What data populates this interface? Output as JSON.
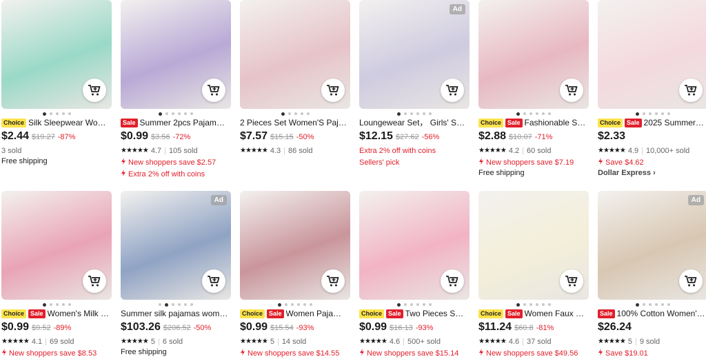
{
  "row1": [
    {
      "badges": [
        "Choice"
      ],
      "title": "Silk Sleepwear Women...",
      "price": "$2.44",
      "orig": "$19.27",
      "disc": "-87%",
      "rating": "",
      "sold": "3 sold",
      "line1": "",
      "line1_type": "",
      "line2": "Free shipping",
      "line2_type": "plain",
      "ad": false,
      "bg": "#9ad9c7",
      "dots": 5,
      "dot_on": 0
    },
    {
      "badges": [
        "Sale"
      ],
      "title": "Summer 2pcs Pajamas S...",
      "price": "$0.99",
      "orig": "$3.56",
      "disc": "-72%",
      "rating": "4.7",
      "sold": "105 sold",
      "line1": "New shoppers save $2.57",
      "line1_type": "red",
      "line2": "Extra 2% off with coins",
      "line2_type": "red",
      "ad": false,
      "bg": "#b8a9d6",
      "dots": 6,
      "dot_on": 0
    },
    {
      "badges": [],
      "title": "2 Pieces Set Women'S Pajama...",
      "price": "$7.57",
      "orig": "$15.15",
      "disc": "-50%",
      "rating": "4.3",
      "sold": "86 sold",
      "line1": "",
      "line1_type": "",
      "line2": "",
      "line2_type": "",
      "ad": false,
      "bg": "#e6c3c9",
      "dots": 5,
      "dot_on": 0
    },
    {
      "badges": [],
      "title": "Loungewear Set， Girls' Sum...",
      "price": "$12.15",
      "orig": "$27.62",
      "disc": "-56%",
      "rating": "",
      "sold": "",
      "line1": "Extra 2% off with coins",
      "line1_type": "redplain",
      "line2": "Sellers' pick",
      "line2_type": "redplain",
      "ad": true,
      "bg": "#cfcbe0",
      "dots": 6,
      "dot_on": 0
    },
    {
      "badges": [
        "Choice",
        "Sale"
      ],
      "title": "Fashionable Sexy I...",
      "price": "$2.88",
      "orig": "$10.07",
      "disc": "-71%",
      "rating": "4.2",
      "sold": "60 sold",
      "line1": "New shoppers save $7.19",
      "line1_type": "red",
      "line2": "Free shipping",
      "line2_type": "plain",
      "ad": false,
      "bg": "#e8b8c2",
      "dots": 6,
      "dot_on": 0
    },
    {
      "badges": [
        "Choice",
        "Sale"
      ],
      "title": "2025 Summer 2 P...",
      "price": "$2.33",
      "orig": "",
      "disc": "",
      "rating": "4.9",
      "sold": "10,000+ sold",
      "line1": "Save $4.62",
      "line1_type": "red",
      "line2": "Dollar Express ›",
      "line2_type": "bold",
      "ad": false,
      "bg": "#f4d9df",
      "dots": 6,
      "dot_on": 0
    }
  ],
  "row2": [
    {
      "badges": [
        "Choice",
        "Sale"
      ],
      "title": "Women's Milk Silk ...",
      "price": "$0.99",
      "orig": "$9.52",
      "disc": "-89%",
      "rating": "4.1",
      "sold": "69 sold",
      "line1": "New shoppers save $8.53",
      "line1_type": "red",
      "ad": false,
      "bg": "#e9a3b6",
      "dots": 5,
      "dot_on": 0
    },
    {
      "badges": [],
      "title": "Summer silk pajamas women's...",
      "price": "$103.26",
      "orig": "$206.52",
      "disc": "-50%",
      "rating": "5",
      "sold": "6 sold",
      "line1": "Free shipping",
      "line1_type": "plain",
      "ad": true,
      "bg": "#8fa3c4",
      "dots": 6,
      "dot_on": 1
    },
    {
      "badges": [
        "Choice",
        "Sale"
      ],
      "title": "Women Pajama Se...",
      "price": "$0.99",
      "orig": "$15.54",
      "disc": "-93%",
      "rating": "5",
      "sold": "14 sold",
      "line1": "New shoppers save $14.55",
      "line1_type": "red",
      "ad": false,
      "bg": "#c9959b",
      "dots": 6,
      "dot_on": 0
    },
    {
      "badges": [
        "Choice",
        "Sale"
      ],
      "title": "Two Pieces Summ...",
      "price": "$0.99",
      "orig": "$16.13",
      "disc": "-93%",
      "rating": "4.6",
      "sold": "500+ sold",
      "line1": "New shoppers save $15.14",
      "line1_type": "red",
      "ad": false,
      "bg": "#f2b3c5",
      "dots": 6,
      "dot_on": 0
    },
    {
      "badges": [
        "Choice",
        "Sale"
      ],
      "title": "Women Faux Cott...",
      "price": "$11.24",
      "orig": "$60.8",
      "disc": "-81%",
      "rating": "4.6",
      "sold": "37 sold",
      "line1": "New shoppers save $49.56",
      "line1_type": "red",
      "ad": false,
      "bg": "#f3efd9",
      "dots": 6,
      "dot_on": 0
    },
    {
      "badges": [
        "Sale"
      ],
      "title": "100% Cotton Women's P...",
      "price": "$26.24",
      "orig": "",
      "disc": "",
      "rating": "5",
      "sold": "9 sold",
      "line1": "Save $19.01",
      "line1_type": "red",
      "ad": true,
      "bg": "#d8c7b2",
      "dots": 6,
      "dot_on": 0
    }
  ],
  "ad_label": "Ad",
  "colors": {
    "accent_red": "#e0202b",
    "choice_yellow": "#fde34b"
  }
}
